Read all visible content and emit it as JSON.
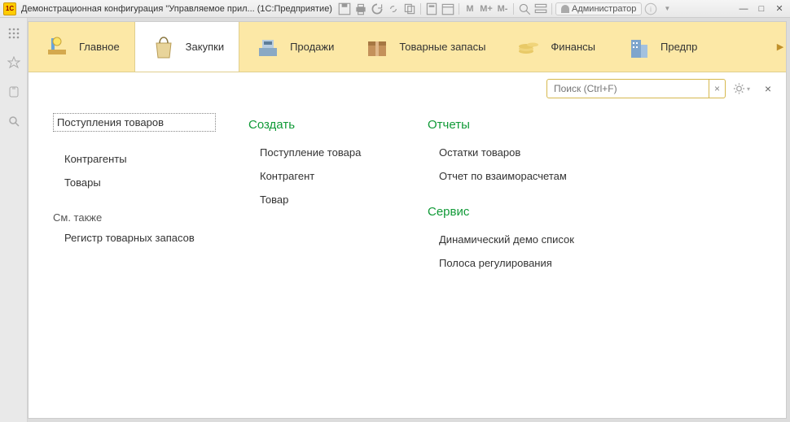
{
  "titlebar": {
    "app_icon_text": "1C",
    "title": "Демонстрационная конфигурация \"Управляемое прил...  (1С:Предприятие)",
    "user_label": "Администратор",
    "memory_buttons": [
      "M",
      "M+",
      "M-"
    ]
  },
  "sections": [
    {
      "label": "Главное",
      "active": false,
      "icon": "desk"
    },
    {
      "label": "Закупки",
      "active": true,
      "icon": "bag"
    },
    {
      "label": "Продажи",
      "active": false,
      "icon": "cashreg"
    },
    {
      "label": "Товарные запасы",
      "active": false,
      "icon": "box"
    },
    {
      "label": "Финансы",
      "active": false,
      "icon": "coins"
    },
    {
      "label": "Предпр",
      "active": false,
      "icon": "building"
    }
  ],
  "search": {
    "placeholder": "Поиск (Ctrl+F)",
    "clear": "×"
  },
  "panel": {
    "col1": {
      "items_top": [
        {
          "label": "Поступления товаров",
          "selected": true
        },
        {
          "label": "Контрагенты",
          "selected": false
        },
        {
          "label": "Товары",
          "selected": false
        }
      ],
      "see_also_header": "См. также",
      "see_also_items": [
        {
          "label": "Регистр товарных запасов"
        }
      ]
    },
    "col2": {
      "header": "Создать",
      "items": [
        {
          "label": "Поступление товара"
        },
        {
          "label": "Контрагент"
        },
        {
          "label": "Товар"
        }
      ]
    },
    "col3": {
      "reports_header": "Отчеты",
      "reports_items": [
        {
          "label": "Остатки товаров"
        },
        {
          "label": "Отчет по взаиморасчетам"
        }
      ],
      "service_header": "Сервис",
      "service_items": [
        {
          "label": "Динамический демо список"
        },
        {
          "label": "Полоса регулирования"
        }
      ]
    }
  }
}
